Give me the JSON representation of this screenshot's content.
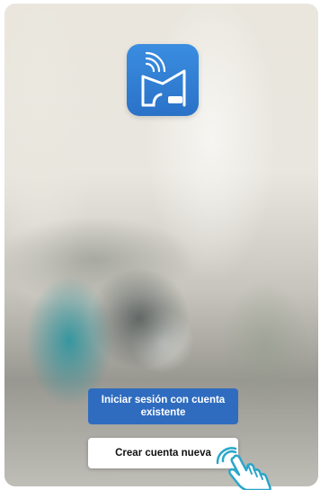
{
  "screen": {
    "logo_icon": "house-wifi-icon",
    "pointer_icon": "tap-hand-icon"
  },
  "actions": {
    "login_label": "Iniciar sesión con cuenta existente",
    "create_label": "Crear cuenta nueva"
  },
  "colors": {
    "accent": "#2f6cbf",
    "logo": "#3a8de0"
  }
}
